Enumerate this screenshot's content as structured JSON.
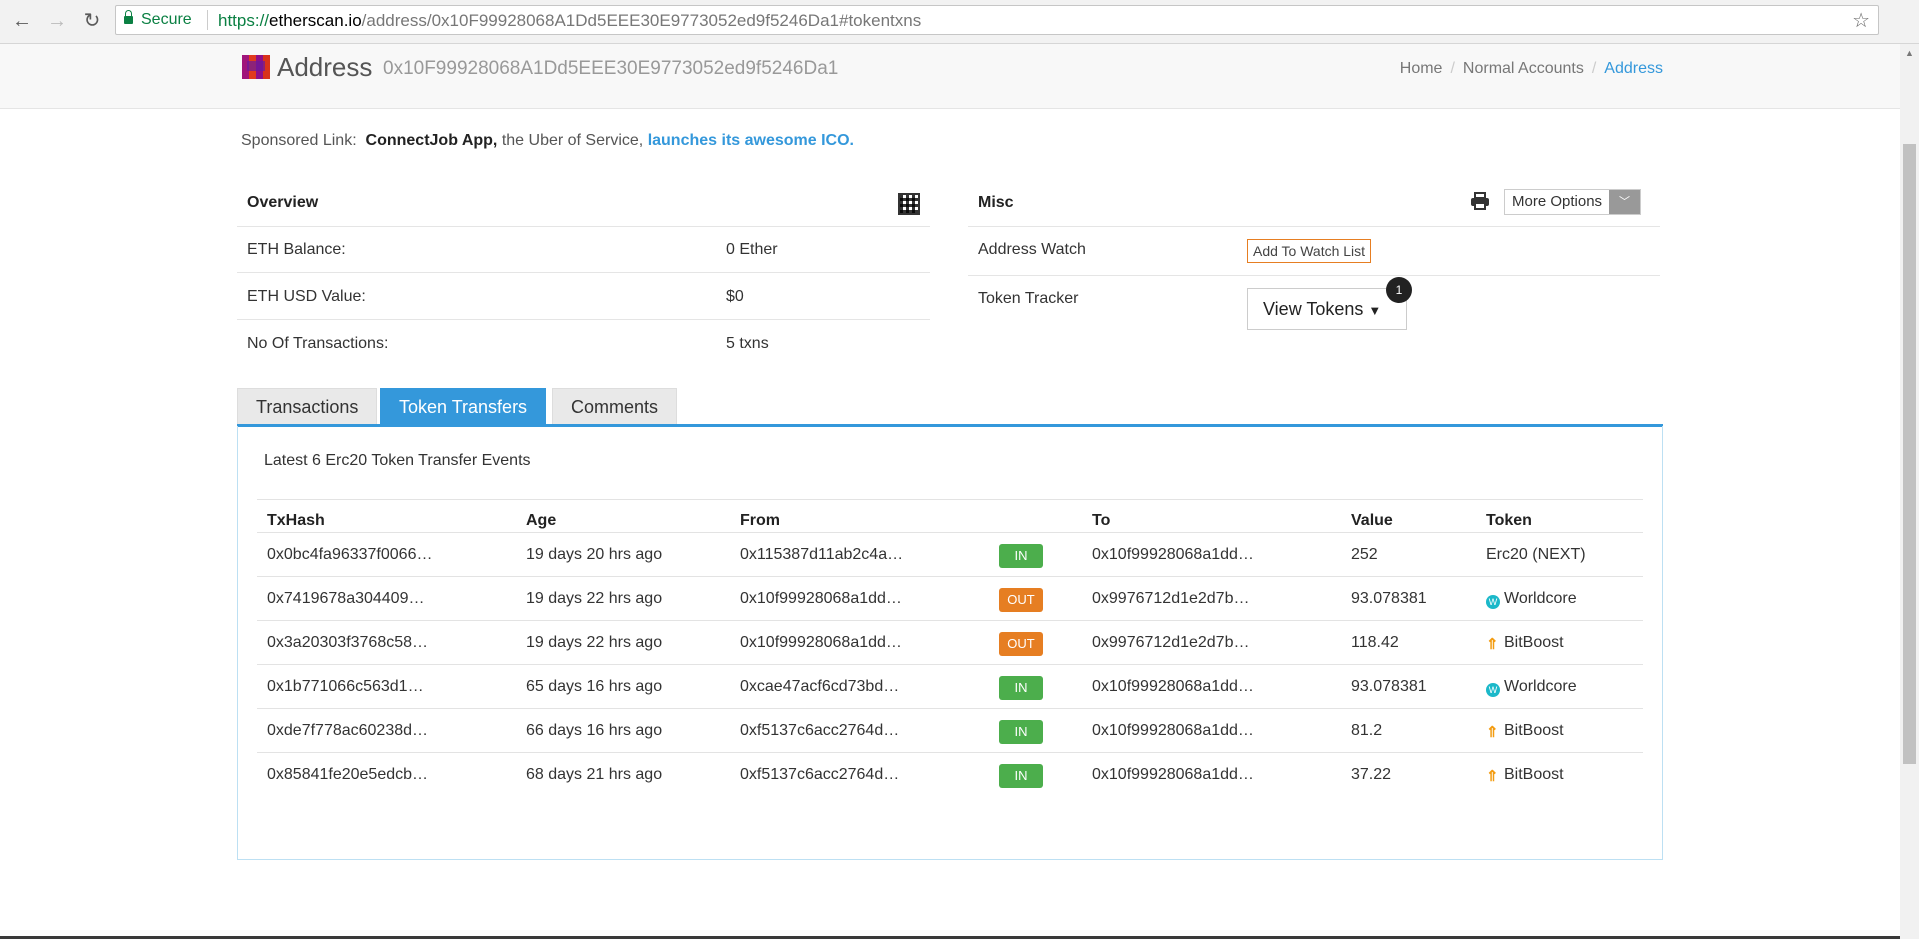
{
  "browser": {
    "secure_label": "Secure",
    "url_scheme": "https://",
    "url_host": "etherscan.io",
    "url_path": "/address/0x10F99928068A1Dd5EEE30E9773052ed9f5246Da1#tokentxns"
  },
  "header": {
    "title": "Address",
    "hash": "0x10F99928068A1Dd5EEE30E9773052ed9f5246Da1",
    "breadcrumb": [
      "Home",
      "Normal Accounts",
      "Address"
    ]
  },
  "sponsored": {
    "prefix": "Sponsored Link:",
    "name": "ConnectJob App,",
    "middle": "the Uber of Service,",
    "link": "launches its awesome ICO."
  },
  "overview": {
    "title": "Overview",
    "rows": [
      {
        "label": "ETH Balance:",
        "value": "0 Ether"
      },
      {
        "label": "ETH USD Value:",
        "value": "$0"
      },
      {
        "label": "No Of Transactions:",
        "value": "5 txns"
      }
    ]
  },
  "misc": {
    "title": "Misc",
    "more_options": "More Options",
    "address_watch_label": "Address Watch",
    "watch_button": "Add To Watch List",
    "token_tracker_label": "Token Tracker",
    "view_tokens": "View Tokens",
    "token_count": "1"
  },
  "tabs": [
    "Transactions",
    "Token Transfers",
    "Comments"
  ],
  "events_title": "Latest 6 Erc20 Token Transfer Events",
  "table": {
    "headers": [
      "TxHash",
      "Age",
      "From",
      "To",
      "Value",
      "Token"
    ],
    "rows": [
      {
        "hash": "0x0bc4fa96337f0066…",
        "age": "19 days 20 hrs ago",
        "from": "0x115387d11ab2c4a…",
        "from_link": true,
        "dir": "IN",
        "to": "0x10f99928068a1dd…",
        "to_link": false,
        "value": "252",
        "token": "Erc20 (NEXT)",
        "token_icon": ""
      },
      {
        "hash": "0x7419678a304409…",
        "age": "19 days 22 hrs ago",
        "from": "0x10f99928068a1dd…",
        "from_link": false,
        "dir": "OUT",
        "to": "0x9976712d1e2d7b…",
        "to_link": true,
        "value": "93.078381",
        "token": "Worldcore",
        "token_icon": "worldcore"
      },
      {
        "hash": "0x3a20303f3768c58…",
        "age": "19 days 22 hrs ago",
        "from": "0x10f99928068a1dd…",
        "from_link": false,
        "dir": "OUT",
        "to": "0x9976712d1e2d7b…",
        "to_link": true,
        "value": "118.42",
        "token": "BitBoost",
        "token_icon": "bitboost"
      },
      {
        "hash": "0x1b771066c563d1…",
        "age": "65 days 16 hrs ago",
        "from": "0xcae47acf6cd73bd…",
        "from_link": true,
        "dir": "IN",
        "to": "0x10f99928068a1dd…",
        "to_link": false,
        "value": "93.078381",
        "token": "Worldcore",
        "token_icon": "worldcore"
      },
      {
        "hash": "0xde7f778ac60238d…",
        "age": "66 days 16 hrs ago",
        "from": "0xf5137c6acc2764d…",
        "from_link": true,
        "dir": "IN",
        "to": "0x10f99928068a1dd…",
        "to_link": false,
        "value": "81.2",
        "token": "BitBoost",
        "token_icon": "bitboost"
      },
      {
        "hash": "0x85841fe20e5edcb…",
        "age": "68 days 21 hrs ago",
        "from": "0xf5137c6acc2764d…",
        "from_link": true,
        "dir": "IN",
        "to": "0x10f99928068a1dd…",
        "to_link": false,
        "value": "37.22",
        "token": "BitBoost",
        "token_icon": "bitboost"
      }
    ]
  },
  "colors": {
    "link": "#3498db",
    "in": "#4cae4c",
    "out": "#e67e22"
  }
}
